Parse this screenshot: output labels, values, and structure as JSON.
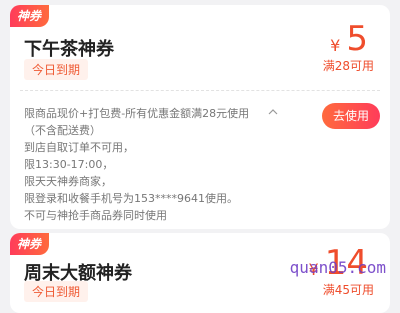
{
  "coupons": [
    {
      "ribbon": "神券",
      "title": "下午茶神券",
      "validity_tag": "今日到期",
      "currency": "¥",
      "amount": "5",
      "min_spend": "满28可用",
      "rules": [
        "限商品现价+打包费-所有优惠金额满28元使用",
        "（不含配送费）",
        "到店自取订单不可用，",
        "限13:30-17:00，",
        "限天天神券商家，",
        "限登录和收餐手机号为153****9641使用。",
        "不可与神抢手商品券同时使用"
      ],
      "use_label": "去使用",
      "expand_icon": "chevron-up-icon"
    },
    {
      "ribbon": "神券",
      "title": "周末大额神券",
      "validity_tag": "今日到期",
      "currency": "¥",
      "amount": "14",
      "min_spend": "满45可用"
    }
  ],
  "watermark": "quan05.com",
  "colors": {
    "accent": "#ef4d2c",
    "ribbon_start": "#ff3c5a",
    "ribbon_end": "#ff6a3d",
    "background": "#f2f2f4"
  }
}
